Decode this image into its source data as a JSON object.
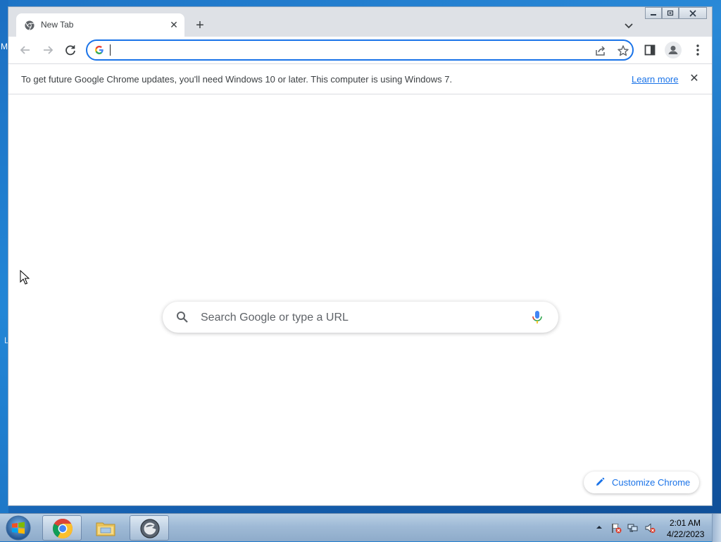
{
  "desktop": {
    "edge_letter_top": "M",
    "edge_letter_mid": "L"
  },
  "browser": {
    "tab": {
      "title": "New Tab",
      "favicon": "chrome-icon"
    },
    "omnibox": {
      "value": "",
      "placeholder": ""
    },
    "infobar": {
      "message": "To get future Google Chrome updates, you'll need Windows 10 or later. This computer is using Windows 7.",
      "link_label": "Learn more"
    },
    "ntp": {
      "search_placeholder": "Search Google or type a URL",
      "customize_label": "Customize Chrome"
    }
  },
  "taskbar": {
    "apps": [
      "chrome-icon",
      "file-explorer-icon",
      "app-icon"
    ],
    "clock": {
      "time": "2:01 AM",
      "date": "4/22/2023"
    }
  },
  "colors": {
    "accent": "#1a73e8",
    "tabstrip": "#dee1e6"
  }
}
